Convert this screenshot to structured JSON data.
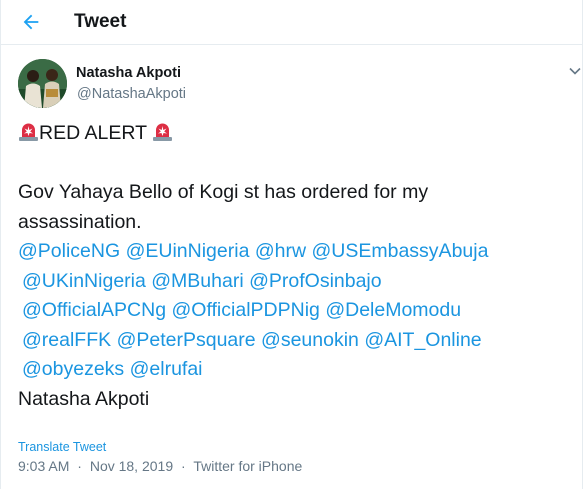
{
  "header": {
    "title": "Tweet",
    "back_icon": "back-arrow-icon"
  },
  "author": {
    "name": "Natasha Akpoti",
    "handle": "@NatashaAkpoti",
    "avatar_icon": "profile-avatar"
  },
  "tweet": {
    "alert_text": "RED ALERT",
    "alert_icon": "police-light-emoji",
    "body_line1": "Gov Yahaya Bello of Kogi st has ordered for my",
    "body_line2": "assassination.",
    "mentions": [
      "@PoliceNG",
      "@EUinNigeria",
      "@hrw",
      "@USEmbassyAbuja",
      "@UKinNigeria",
      "@MBuhari",
      "@ProfOsinbajo",
      "@OfficialAPCNg",
      "@OfficialPDPNig",
      "@DeleMomodu",
      "@realFFK",
      "@PeterPsquare",
      "@seunokin",
      "@AIT_Online",
      "@obyezeks",
      "@elrufai"
    ],
    "signature": "Natasha Akpoti"
  },
  "footer": {
    "translate_label": "Translate Tweet",
    "time": "9:03 AM",
    "date": "Nov 18, 2019",
    "separator": "·",
    "source": "Twitter for iPhone"
  },
  "colors": {
    "link": "#1b95e0",
    "secondary_text": "#657786",
    "primary_text": "#14171a",
    "alert_red": "#e0245e"
  }
}
